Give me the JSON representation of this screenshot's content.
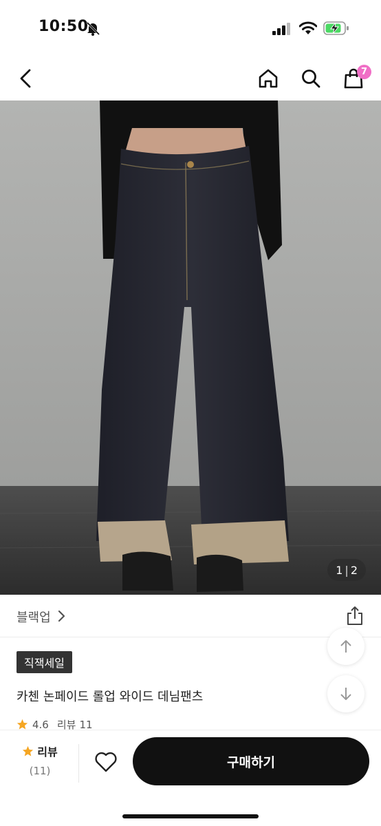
{
  "status_bar": {
    "time": "10:50",
    "icons": [
      "bell-slash-icon",
      "signal-icon",
      "wifi-icon",
      "battery-charging-icon"
    ],
    "battery_color": "#4cd964"
  },
  "nav": {
    "back_icon": "chevron-left-icon",
    "home_icon": "home-icon",
    "search_icon": "search-icon",
    "cart_icon": "shopping-bag-icon",
    "cart_count": "7",
    "badge_color": "#f06fc6"
  },
  "hero": {
    "page_current": "1",
    "page_separator": "|",
    "page_total": "2"
  },
  "product": {
    "brand": "블랙업",
    "tag": "직잭세일",
    "title": "카첸 논페이드 롤업 와이드 데님팬츠",
    "rating": "4.6",
    "review_label": "리뷰",
    "review_count": "11"
  },
  "bottom_bar": {
    "review_label": "리뷰",
    "review_count": "(11)",
    "buy_label": "구매하기",
    "star_color": "#f5a623"
  }
}
